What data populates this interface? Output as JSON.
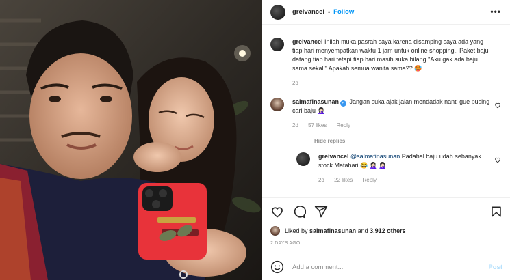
{
  "header": {
    "username": "greivancel",
    "separator": "•",
    "follow_label": "Follow",
    "more_label": "•••"
  },
  "caption": {
    "username": "greivancel",
    "text": "Inilah muka pasrah saya karena disamping saya ada yang tiap hari menyempatkan waktu 1 jam untuk online shopping.. Paket baju datang tiap hari tetapi tiap hari masih suka bilang \"Aku gak ada baju sama sekali\" Apakah semua wanita sama?? 🥵",
    "time": "2d"
  },
  "comments": [
    {
      "username": "salmafinasunan",
      "verified_mark": "✓",
      "text": "Jangan suka ajak jalan mendadak nanti gue pusing cari baju 🤦🏻‍♀️",
      "time": "2d",
      "likes": "57 likes",
      "reply_label": "Reply"
    }
  ],
  "hide_replies_label": "Hide replies",
  "reply": {
    "username": "greivancel",
    "mention": "@salmafinasunan",
    "text": "Padahal baju udah sebanyak stock Matahari 😂 🤦🏻‍♀️ 🤦🏻‍♀️",
    "time": "2d",
    "likes": "22 likes",
    "reply_label": "Reply"
  },
  "actions": {
    "icons": [
      "heart-icon",
      "comment-icon",
      "share-icon",
      "bookmark-icon"
    ]
  },
  "likes": {
    "prefix": "Liked by",
    "user": "salmafinasunan",
    "and": "and",
    "others": "3,912 others"
  },
  "timestamp": "2 DAYS AGO",
  "add_comment": {
    "placeholder": "Add a comment...",
    "post_label": "Post"
  },
  "colors": {
    "accent": "#0095f6",
    "post_disabled": "#b2dffc",
    "muted": "#8e8e8e",
    "phone_case": "#e8333a"
  }
}
